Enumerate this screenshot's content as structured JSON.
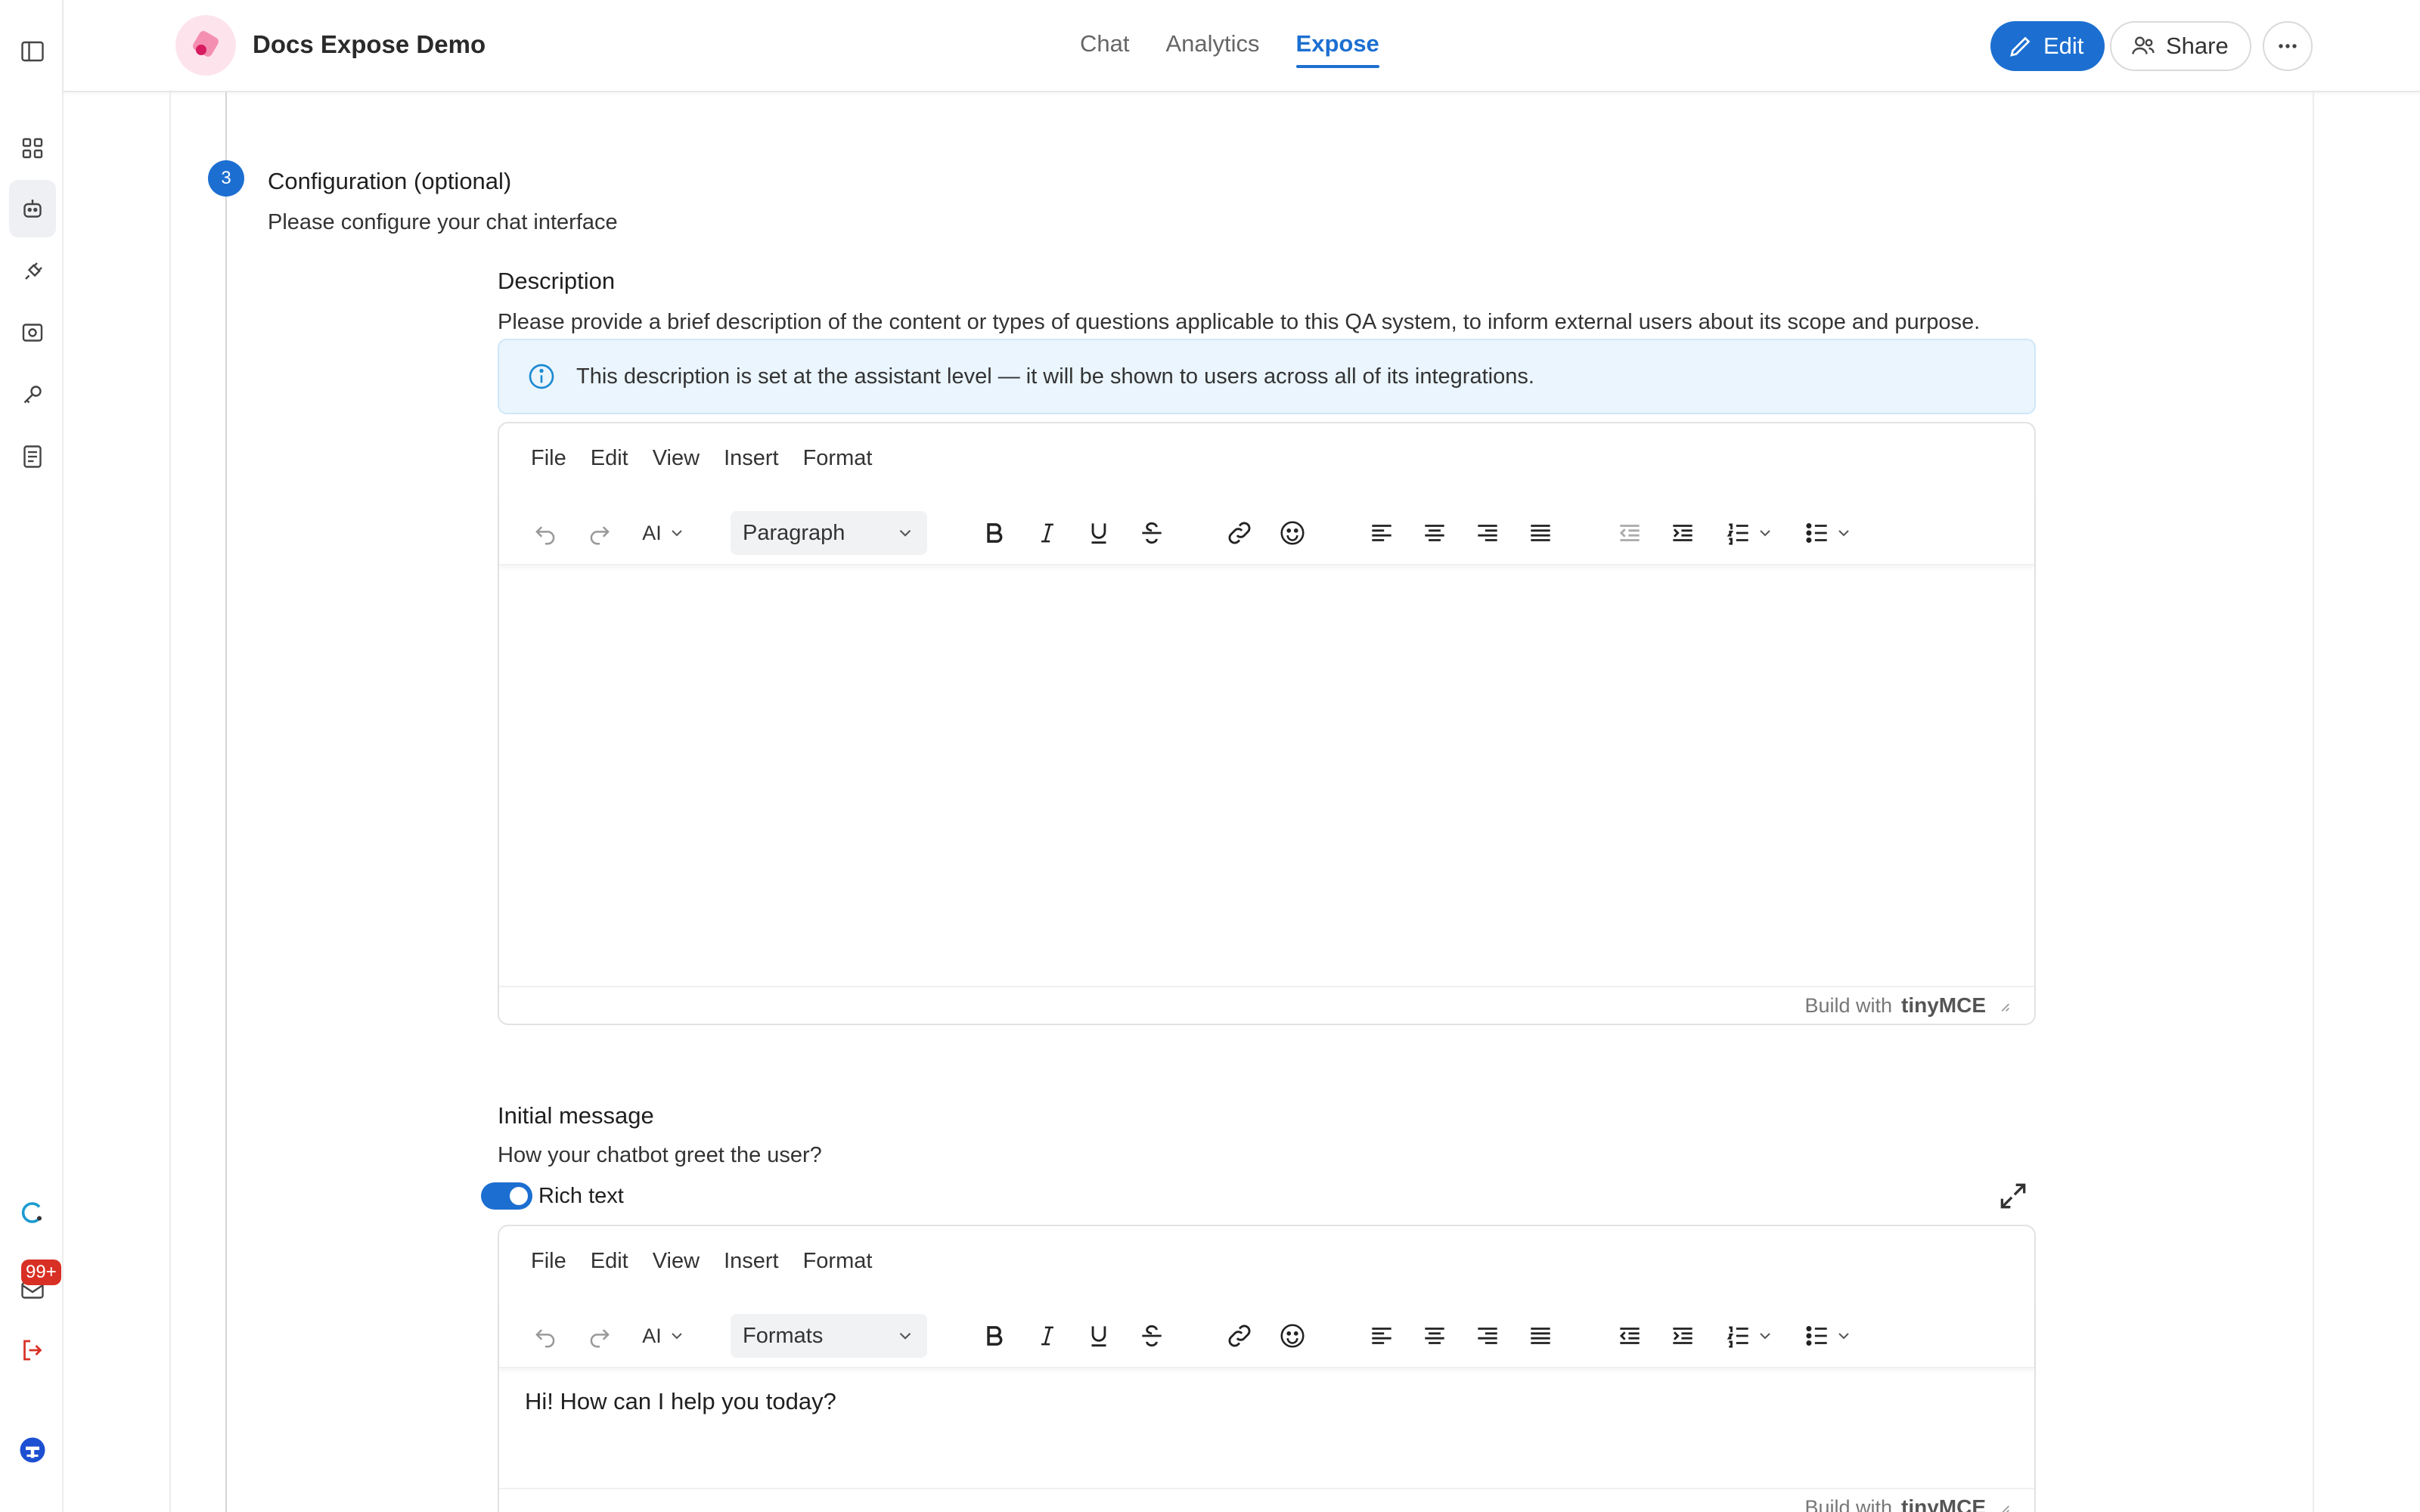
{
  "app": {
    "title": "Docs Expose Demo",
    "tabs": [
      {
        "label": "Chat",
        "active": false
      },
      {
        "label": "Analytics",
        "active": false
      },
      {
        "label": "Expose",
        "active": true
      }
    ],
    "actions": {
      "edit": "Edit",
      "share": "Share"
    }
  },
  "rail": {
    "items": [
      "sidebar-toggle-icon",
      "apps-grid-icon",
      "bot-icon",
      "plug-icon",
      "scan-icon",
      "key-icon",
      "document-icon"
    ],
    "bottom": {
      "notification_count": "99+"
    }
  },
  "step": {
    "number": "3",
    "title": "Configuration (optional)",
    "subtitle": "Please configure your chat interface"
  },
  "description": {
    "label": "Description",
    "hint": "Please provide a brief description of the content or types of questions applicable to this QA system, to inform external users about its scope and purpose.",
    "info": "This description is set at the assistant level — it will be shown to users across all of its integrations.",
    "editor": {
      "menu": [
        "File",
        "Edit",
        "View",
        "Insert",
        "Format"
      ],
      "ai_label": "AI",
      "block_format": "Paragraph",
      "content": "",
      "status": {
        "built_with": "Build with",
        "brand": "tinyMCE"
      }
    }
  },
  "initial_message": {
    "label": "Initial message",
    "hint": "How your chatbot greet the user?",
    "rich_text_label": "Rich text",
    "rich_text_enabled": true,
    "editor": {
      "menu": [
        "File",
        "Edit",
        "View",
        "Insert",
        "Format"
      ],
      "ai_label": "AI",
      "block_format": "Formats",
      "content": "Hi! How can I help you today?",
      "status": {
        "built_with": "Build with",
        "brand": "tinyMCE"
      }
    }
  },
  "colors": {
    "accent": "#1c6fd1",
    "badge": "#d93025",
    "info_bg": "#eaf5fd"
  }
}
